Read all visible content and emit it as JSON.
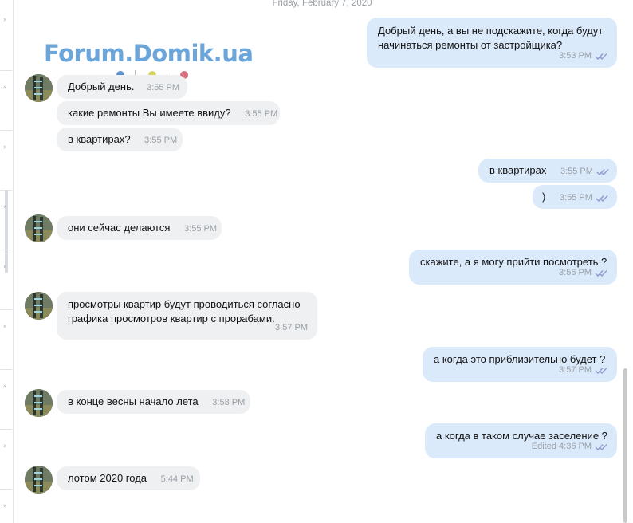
{
  "date_header": "Friday, February 7, 2020",
  "watermark": {
    "text": "Forum.Domik.ua",
    "dot_colors": [
      "#5b8fd0",
      "#d7d75f",
      "#d6707e"
    ]
  },
  "colors": {
    "incoming_bubble": "#eef0f2",
    "outgoing_bubble": "#dbeafb",
    "read_check": "#8a98cc"
  },
  "messages": [
    {
      "dir": "out",
      "text": "Добрый день, а вы не подскажите, когда будут начинаться ремонты от застройщика?",
      "time": "3:53 PM",
      "status": "read"
    },
    {
      "dir": "in",
      "text": "Добрый день.",
      "time": "3:55 PM"
    },
    {
      "dir": "in",
      "text": "какие ремонты Вы имеете ввиду?",
      "time": "3:55 PM"
    },
    {
      "dir": "in",
      "text": "в квартирах?",
      "time": "3:55 PM"
    },
    {
      "dir": "out",
      "text": "в квартирах",
      "time": "3:55 PM",
      "status": "read"
    },
    {
      "dir": "out",
      "text": ")",
      "time": "3:55 PM",
      "status": "read"
    },
    {
      "dir": "in",
      "text": "они сейчас делаются",
      "time": "3:55 PM"
    },
    {
      "dir": "out",
      "text": "скажите, а я могу прийти посмотреть ?",
      "time": "3:56 PM",
      "status": "read"
    },
    {
      "dir": "in",
      "text": "просмотры квартир будут проводиться согласно графика просмотров квартир с прорабами.",
      "time": "3:57 PM"
    },
    {
      "dir": "out",
      "text": "а когда это приблизительно будет ?",
      "time": "3:57 PM",
      "status": "read"
    },
    {
      "dir": "in",
      "text": "в конце весны начало лета",
      "time": "3:58 PM"
    },
    {
      "dir": "out",
      "text": "а когда в таком случае заселение ?",
      "time": "Edited 4:36 PM",
      "status": "read"
    },
    {
      "dir": "in",
      "text": "лотом 2020 года",
      "time": "5:44 PM"
    }
  ]
}
